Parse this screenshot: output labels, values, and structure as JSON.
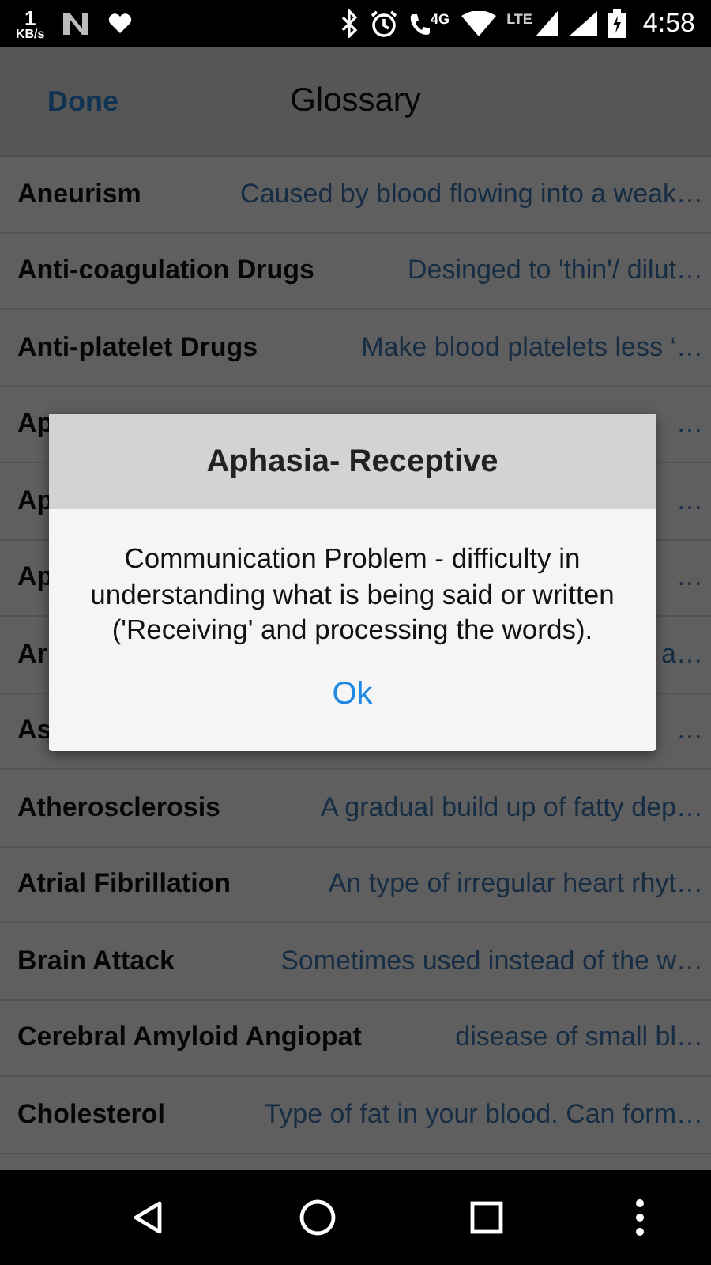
{
  "status_bar": {
    "speed": "1",
    "speed_unit": "KB/s",
    "network": "4G",
    "lte": "LTE",
    "time": "4:58"
  },
  "header": {
    "done": "Done",
    "title": "Glossary"
  },
  "entries": [
    {
      "term": "Aneurism",
      "definition": "Caused by blood flowing into a weak…"
    },
    {
      "term": "Anti-coagulation Drugs",
      "definition": "Desinged to 'thin'/ dilut…"
    },
    {
      "term": "Anti-platelet Drugs",
      "definition": "Make blood platelets less ‘…"
    },
    {
      "term": "Ap",
      "definition": "…"
    },
    {
      "term": "Ap",
      "definition": "…"
    },
    {
      "term": "Ap",
      "definition": "…"
    },
    {
      "term": "Ar",
      "definition": "a…"
    },
    {
      "term": "As",
      "definition": "…"
    },
    {
      "term": "Atherosclerosis",
      "definition": "A gradual build up of fatty dep…"
    },
    {
      "term": "Atrial Fibrillation",
      "definition": "An type of irregular heart rhyt…"
    },
    {
      "term": "Brain Attack",
      "definition": "Sometimes used instead of the w…"
    },
    {
      "term": "Cerebral Amyloid Angiopat",
      "definition": "disease of small bl…"
    },
    {
      "term": "Cholesterol",
      "definition": "Type of fat in your blood. Can form…"
    }
  ],
  "dialog": {
    "title": "Aphasia- Receptive",
    "message": "Communication Problem - difficulty in understanding what is being said or written ('Receiving' and processing the words).",
    "button": "Ok"
  }
}
